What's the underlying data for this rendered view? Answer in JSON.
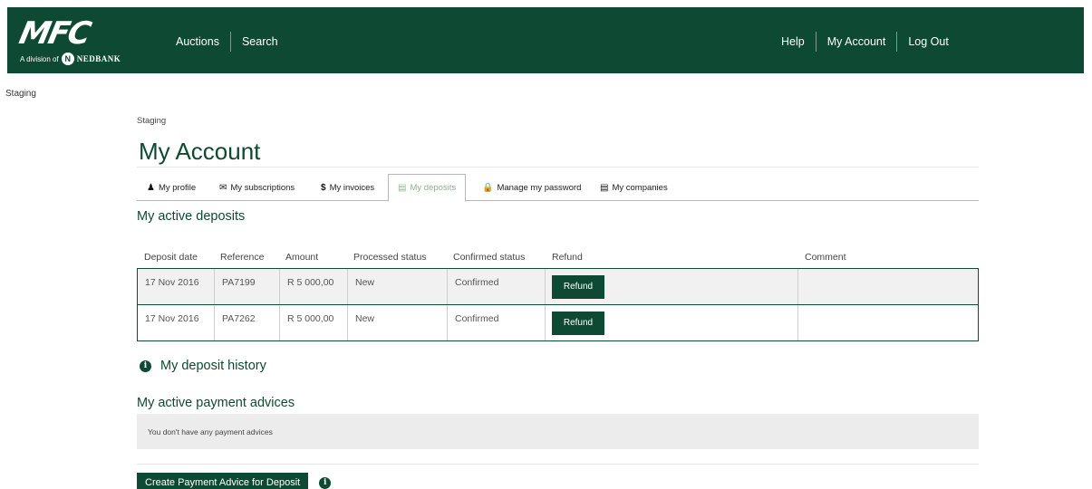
{
  "header": {
    "logo_text": "MFC",
    "logo_sub": "A division of",
    "logo_bank": "NEDBANK",
    "nav_left": [
      "Auctions",
      "Search"
    ],
    "nav_right": [
      "Help",
      "My Account",
      "Log Out"
    ]
  },
  "env_label": "Staging",
  "breadcrumb": "Staging",
  "page_title": "My Account",
  "tabs": [
    {
      "label": "My profile",
      "icon": "user-icon"
    },
    {
      "label": "My subscriptions",
      "icon": "envelope-icon"
    },
    {
      "label": "My invoices",
      "icon": "dollar-icon"
    },
    {
      "label": "My deposits",
      "icon": "money-icon",
      "active": true
    },
    {
      "label": "Manage my password",
      "icon": "lock-icon"
    },
    {
      "label": "My companies",
      "icon": "briefcase-icon"
    }
  ],
  "active_deposits": {
    "heading": "My active deposits",
    "columns": [
      "Deposit date",
      "Reference",
      "Amount",
      "Processed status",
      "Confirmed status",
      "Refund",
      "Comment"
    ],
    "rows": [
      {
        "date": "17 Nov 2016",
        "reference": "PA7199",
        "amount": "R 5 000,00",
        "processed": "New",
        "confirmed": "Confirmed",
        "refund_label": "Refund",
        "comment": ""
      },
      {
        "date": "17 Nov 2016",
        "reference": "PA7262",
        "amount": "R 5 000,00",
        "processed": "New",
        "confirmed": "Confirmed",
        "refund_label": "Refund",
        "comment": ""
      }
    ]
  },
  "deposit_history": "My deposit history",
  "payment_advices": {
    "heading": "My active payment advices",
    "empty_text": "You don't have any payment advices",
    "create_label": "Create Payment Advice for Deposit"
  },
  "colors": {
    "brand": "#0e4a33",
    "active_tab": "#8fb38f"
  }
}
